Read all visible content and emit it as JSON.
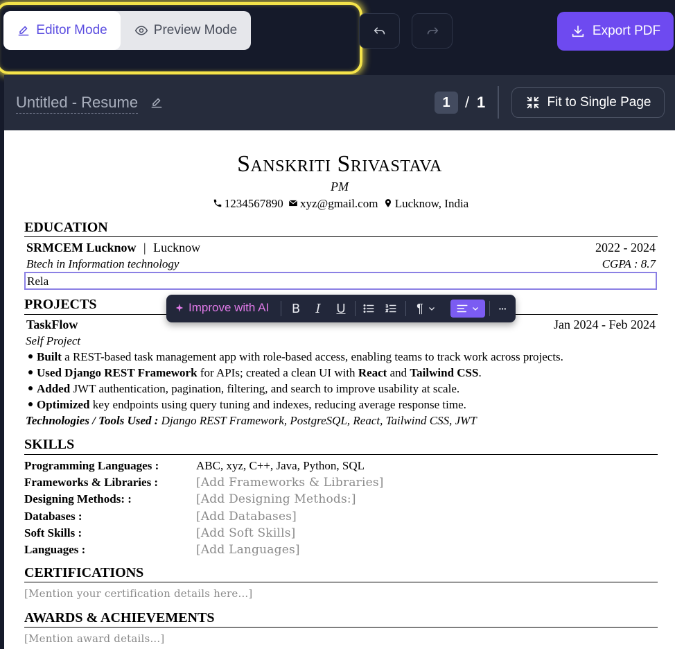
{
  "toolbar": {
    "editor_mode_label": "Editor Mode",
    "preview_mode_label": "Preview Mode",
    "export_label": "Export PDF",
    "accent": "#6e4af0",
    "highlight_color": "#f4e34a"
  },
  "titlebar": {
    "doc_title": "Untitled - Resume",
    "page_current": "1",
    "page_sep": "/",
    "page_total": "1",
    "fit_label": "Fit to Single Page"
  },
  "resume": {
    "name": "Sanskriti Srivastava",
    "role": "PM",
    "phone": "1234567890",
    "email": "xyz@gmail.com",
    "location": "Lucknow, India",
    "education": {
      "heading": "EDUCATION",
      "school": "SRMCEM Lucknow",
      "sep": "|",
      "city": "Lucknow",
      "years": "2022 - 2024",
      "degree": "Btech in Information technology",
      "gpa": "CGPA : 8.7",
      "editing_text": "Rela"
    },
    "projects": {
      "heading": "PROJECTS",
      "title": "TaskFlow",
      "dates": "Jan 2024 - Feb 2024",
      "type": "Self Project",
      "bullets": [
        {
          "b": "Built",
          "t": " a REST-based task management app with role-based access, enabling teams to track work across projects."
        },
        {
          "b": "Used Django REST Framework",
          "t": " for APIs; created a clean UI with ",
          "b2": "React",
          "t2": " and ",
          "b3": "Tailwind CSS",
          "t3": "."
        },
        {
          "b": "Added",
          "t": " JWT authentication, pagination, filtering, and search to improve usability at scale."
        },
        {
          "b": "Optimized",
          "t": " key endpoints using query tuning and indexes, reducing average response time."
        }
      ],
      "tech_label": "Technologies / Tools Used :",
      "tech_value": " Django REST Framework, PostgreSQL, React, Tailwind CSS, JWT"
    },
    "skills": {
      "heading": "SKILLS",
      "rows": [
        {
          "key": "Programming Languages :",
          "value": "ABC, xyz, C++, Java, Python, SQL"
        },
        {
          "key": "Frameworks & Libraries :",
          "value": "[Add Frameworks & Libraries]"
        },
        {
          "key": "Designing Methods: :",
          "value": "[Add Designing Methods:]"
        },
        {
          "key": "Databases :",
          "value": "[Add Databases]"
        },
        {
          "key": "Soft Skills :",
          "value": "[Add Soft Skills]"
        },
        {
          "key": "Languages :",
          "value": "[Add Languages]"
        }
      ]
    },
    "certifications": {
      "heading": "CERTIFICATIONS",
      "placeholder": "[Mention your certification details here...]"
    },
    "awards": {
      "heading": "AWARDS & ACHIEVEMENTS",
      "placeholder": "[Mention award details...]"
    }
  },
  "format_toolbar": {
    "ai_label": "Improve with AI",
    "bold": "B",
    "italic": "I",
    "underline": "U",
    "paragraph": "¶",
    "more": "···"
  }
}
